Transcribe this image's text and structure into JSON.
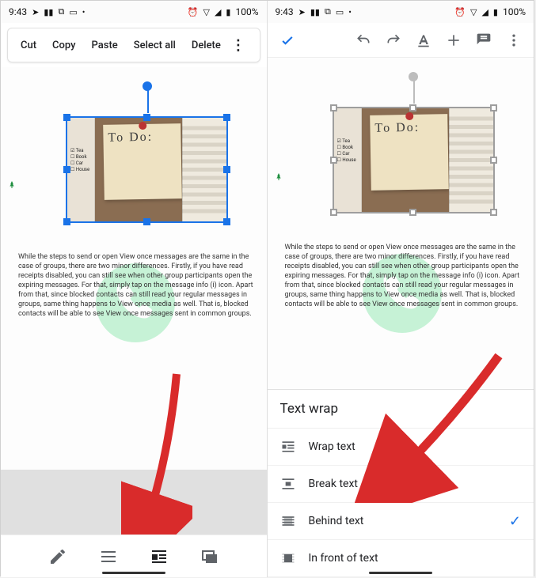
{
  "status": {
    "time": "9:43",
    "battery": "100%",
    "icons_left": [
      "send-icon",
      "pause-icon",
      "voicemail-icon",
      "image-icon",
      "dot-icon"
    ],
    "icons_right": [
      "alarm-icon",
      "wifi-icon",
      "signal-icon",
      "battery-icon"
    ]
  },
  "left": {
    "context_menu": [
      "Cut",
      "Copy",
      "Paste",
      "Select all",
      "Delete"
    ],
    "image": {
      "selected": true,
      "handle_color": "blue",
      "sticky_text": "To Do:",
      "checklist": [
        "Tea",
        "Book",
        "Car",
        "House"
      ]
    },
    "body_text": "While the steps to send or open View once messages are the same in the case of groups, there are two minor differences. Firstly, if you have read receipts disabled, you can still see when other group participants open the expiring messages. For that, simply tap on the message info (i) icon. Apart from that, since blocked contacts can still read your regular messages in groups, same thing happens to View once media as well. That is, blocked contacts will be able to see View once messages sent in common groups.",
    "bottom_toolbar": [
      {
        "name": "edit-icon",
        "active": false
      },
      {
        "name": "align-icon",
        "active": false
      },
      {
        "name": "text-wrap-icon",
        "active": true
      },
      {
        "name": "image-replace-icon",
        "active": false
      }
    ]
  },
  "right": {
    "appbar": {
      "check": true,
      "actions": [
        "undo-icon",
        "redo-icon",
        "text-format-icon",
        "add-icon",
        "comment-icon",
        "more-icon"
      ]
    },
    "image": {
      "selected": true,
      "handle_color": "gray",
      "sticky_text": "To Do:",
      "checklist": [
        "Tea",
        "Book",
        "Car",
        "House"
      ]
    },
    "body_text": "While the steps to send or open View once messages are the same in the case of groups, there are two minor differences. Firstly, if you have read receipts disabled, you can still see when other group participants open the expiring messages. For that, simply tap on the message info (i) icon. Apart from that, since blocked contacts can still read your regular messages in groups, same thing happens to View once media as well. That is, blocked contacts will be able to see View once messages sent in common groups.",
    "sheet": {
      "title": "Text wrap",
      "options": [
        {
          "label": "Wrap text",
          "icon": "wrap-text-icon",
          "selected": false
        },
        {
          "label": "Break text",
          "icon": "break-text-icon",
          "selected": false
        },
        {
          "label": "Behind text",
          "icon": "behind-text-icon",
          "selected": true
        },
        {
          "label": "In front of text",
          "icon": "front-text-icon",
          "selected": false
        }
      ]
    }
  },
  "colors": {
    "accent": "#1a73e8",
    "muted": "#5f6368",
    "green": "#1e8e3e"
  }
}
